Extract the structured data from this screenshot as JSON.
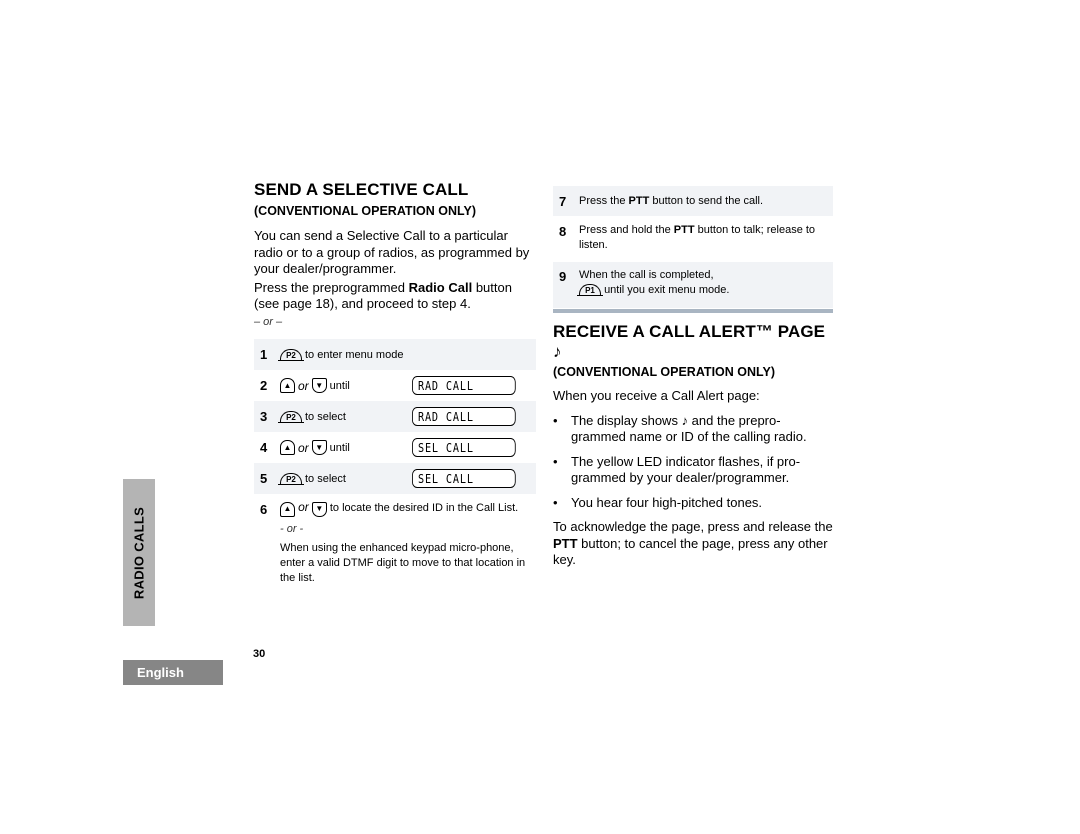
{
  "left": {
    "title": "SEND A SELECTIVE CALL",
    "subtitle": "(CONVENTIONAL OPERATION ONLY)",
    "intro": "You can send a Selective Call to a particular radio or to a group of radios, as programmed by your dealer/programmer.",
    "press_prefix": "Press the preprogrammed ",
    "press_bold": "Radio Call",
    "press_suffix": " button (see page 18), and proceed to step 4.",
    "or_label": "– or –",
    "steps": [
      {
        "num": "1",
        "key": "P2",
        "text": "to enter menu mode"
      },
      {
        "num": "2",
        "or": "or",
        "text": "until",
        "display": "RAD CALL"
      },
      {
        "num": "3",
        "key": "P2",
        "text": "to select",
        "display": "RAD CALL"
      },
      {
        "num": "4",
        "or": "or",
        "text": "until",
        "display": "SEL CALL"
      },
      {
        "num": "5",
        "key": "P2",
        "text": "to select",
        "display": "SEL CALL"
      },
      {
        "num": "6",
        "or": "or",
        "text": "to locate the desired ID in the Call List.",
        "alt_or": "- or -",
        "alt_text": "When using the enhanced keypad micro-phone, enter a valid DTMF digit to move to that location in the list."
      }
    ],
    "page_number": "30"
  },
  "right": {
    "steps": [
      {
        "num": "7",
        "pre": "Press the ",
        "bold": "PTT",
        "post": " button to send the call."
      },
      {
        "num": "8",
        "pre": "Press and hold the ",
        "bold": "PTT",
        "post": " button to talk; release to listen."
      },
      {
        "num": "9",
        "line1": "When the call is completed,",
        "key": "P1",
        "line2": "until you exit menu mode."
      }
    ],
    "title": "RECEIVE A CALL ALERT™ PAGE",
    "title_icon": "♪",
    "subtitle": "(CONVENTIONAL OPERATION ONLY)",
    "intro": "When you receive a Call Alert page:",
    "bullets": [
      {
        "pre": "The display shows ",
        "icon": "♪",
        "post": " and the prepro-grammed name or ID of the calling radio."
      },
      {
        "text": "The yellow LED indicator flashes, if pro-grammed by your dealer/programmer."
      },
      {
        "text": "You hear four high-pitched tones."
      }
    ],
    "ack_pre": "To acknowledge the page, press and release the ",
    "ack_bold": "PTT",
    "ack_post": " button; to cancel the page, press any other key."
  },
  "side_tab": "RADIO CALLS",
  "language_tab": "English",
  "arrows": {
    "up": "▲",
    "down": "▼"
  }
}
